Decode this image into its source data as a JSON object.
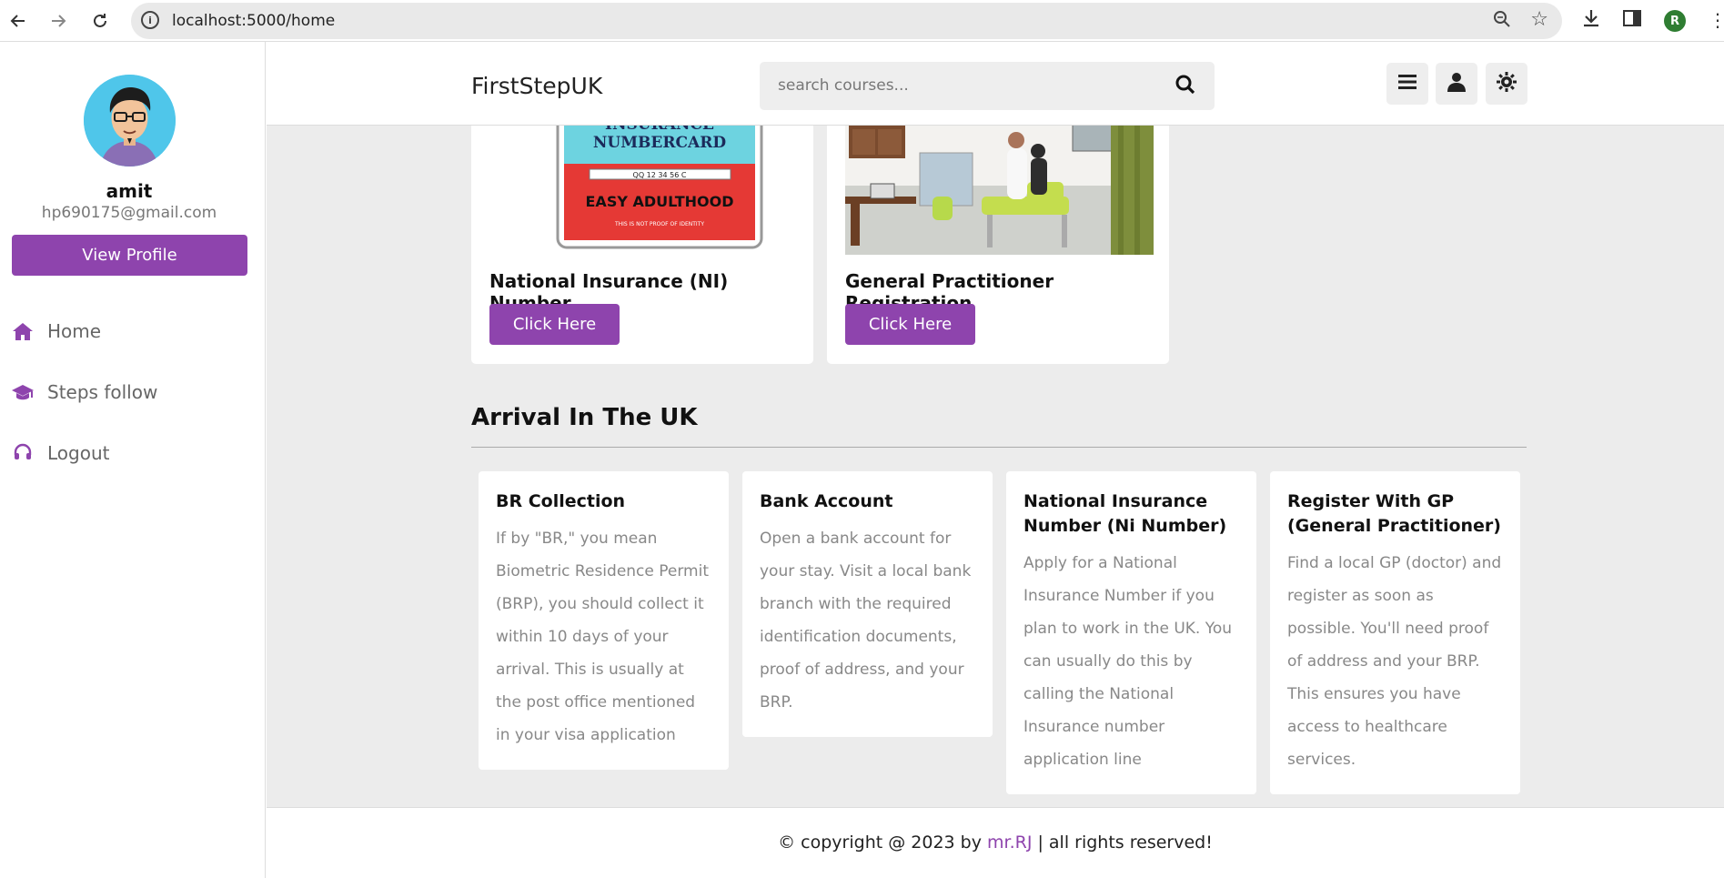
{
  "browser": {
    "url": "localhost:5000/home",
    "avatar_letter": "R"
  },
  "sidebar": {
    "user_name": "amit",
    "user_email": "hp690175@gmail.com",
    "view_profile_label": "View Profile",
    "items": [
      {
        "label": "Home",
        "icon": "home-icon"
      },
      {
        "label": "Steps follow",
        "icon": "graduation-cap-icon"
      },
      {
        "label": "Logout",
        "icon": "headset-icon"
      }
    ]
  },
  "header": {
    "logo": "FirstStepUK",
    "search_placeholder": "search courses..."
  },
  "top_cards": [
    {
      "title": "National Insurance (NI) Number",
      "button": "Click Here",
      "image_text": {
        "line1": "INSURANCE",
        "line2": "NUMBERCARD",
        "number": "QQ 12 34 56 C",
        "banner": "EASY ADULTHOOD",
        "fine": "THIS IS NOT PROOF OF IDENTITY"
      }
    },
    {
      "title": "General Practitioner Registration",
      "button": "Click Here"
    }
  ],
  "section": {
    "title": "Arrival In The UK"
  },
  "info_cards": [
    {
      "title": "BR Collection",
      "text": "If by \"BR,\" you mean Biometric Residence Permit (BRP), you should collect it within 10 days of your arrival. This is usually at the post office mentioned in your visa application"
    },
    {
      "title": "Bank Account",
      "text": "Open a bank account for your stay. Visit a local bank branch with the required identification documents, proof of address, and your BRP."
    },
    {
      "title": "National Insurance Number (Ni Number)",
      "text": "Apply for a National Insurance Number if you plan to work in the UK. You can usually do this by calling the National Insurance number application line"
    },
    {
      "title": "Register With GP (General Practitioner)",
      "text": "Find a local GP (doctor) and register as soon as possible. You'll need proof of address and your BRP. This ensures you have access to healthcare services."
    }
  ],
  "footer": {
    "prefix": "© copyright @ 2023 by ",
    "brand": "mr.RJ",
    "suffix": " | all rights reserved!"
  },
  "colors": {
    "accent": "#8e44ad",
    "main_bg": "#ececec"
  }
}
